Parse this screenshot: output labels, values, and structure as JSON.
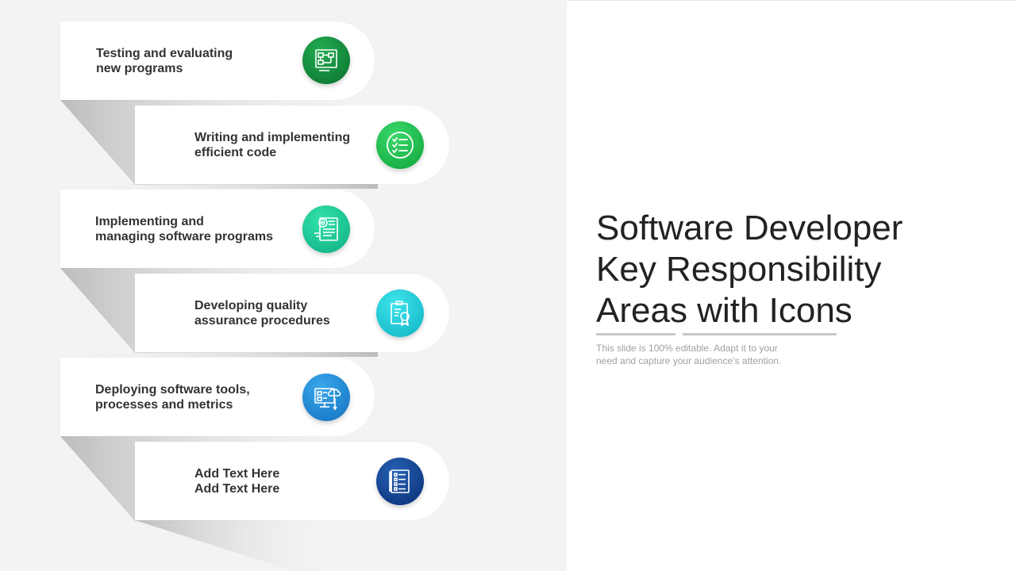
{
  "items": [
    {
      "line1": "Testing and evaluating",
      "line2": "new programs",
      "icon": "flowchart-icon",
      "color_light": "#1fa34a",
      "color_dark": "#0b6f2e"
    },
    {
      "line1": "Writing and implementing",
      "line2": "efficient code",
      "icon": "checklist-icon",
      "color_light": "#2fd060",
      "color_dark": "#10a83c"
    },
    {
      "line1": "Implementing and",
      "line2": "managing software programs",
      "icon": "gear-document-icon",
      "color_light": "#2be0a8",
      "color_dark": "#11b283"
    },
    {
      "line1": "Developing quality",
      "line2": "assurance procedures",
      "icon": "quality-badge-icon",
      "color_light": "#2fe2ea",
      "color_dark": "#11b5c4"
    },
    {
      "line1": "Deploying software tools,",
      "line2": "processes and metrics",
      "icon": "monitor-cloud-icon",
      "color_light": "#36aaf0",
      "color_dark": "#1273c2"
    },
    {
      "line1": "Add Text Here",
      "line2": "Add Text Here",
      "icon": "document-list-icon",
      "color_light": "#1f5fb5",
      "color_dark": "#0c3278"
    }
  ],
  "title": {
    "line1": "Software Developer",
    "line2": "Key Responsibility",
    "line3": "Areas with Icons"
  },
  "subtitle": {
    "line1": "This slide is 100% editable. Adapt it to your",
    "line2": "need and capture your audience’s attention."
  }
}
